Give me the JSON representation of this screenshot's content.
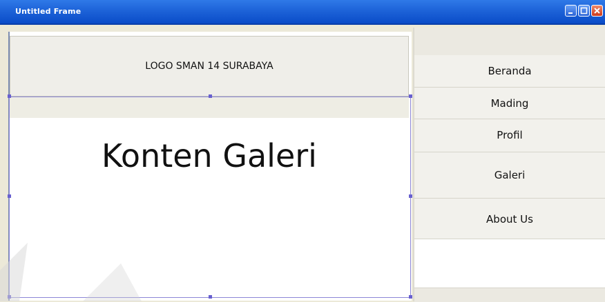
{
  "window": {
    "title": "Untitled Frame"
  },
  "header": {
    "logo_text": "LOGO SMAN 14 SURABAYA"
  },
  "content": {
    "title": "Konten Galeri"
  },
  "nav": {
    "items": [
      {
        "label": "Beranda"
      },
      {
        "label": "Mading"
      },
      {
        "label": "Profil"
      },
      {
        "label": "Galeri"
      },
      {
        "label": "About Us"
      }
    ]
  },
  "colors": {
    "titlebar": "#1d63d8",
    "panel_bg": "#ece9d8",
    "selection": "#6860cf"
  },
  "icons": {
    "minimize": "minimize-icon",
    "maximize": "maximize-icon",
    "close": "close-icon"
  }
}
